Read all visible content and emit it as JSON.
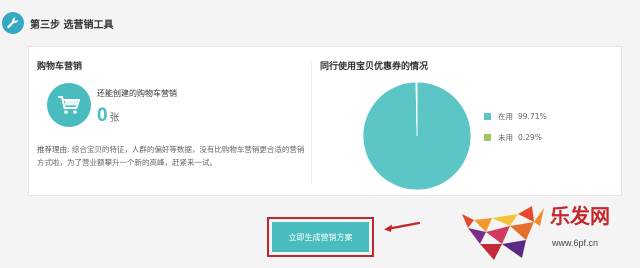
{
  "step": {
    "title": "第三步 选营销工具",
    "icon": "wrench-icon"
  },
  "left_panel": {
    "title": "购物车营销",
    "icon": "shopping-cart-icon",
    "created_label": "还能创建的购物车营销",
    "count": "0",
    "count_unit": "张",
    "reason_label": "推荐理由:",
    "reason_text": "综合宝贝的特征，人群的偏好等数据，没有比购物车营销更合适的营销方式啦，为了营业额攀升一个新的高峰，赶紧来一试。"
  },
  "right_panel": {
    "title": "同行使用宝贝优惠券的情况"
  },
  "chart_data": {
    "type": "pie",
    "title": "同行使用宝贝优惠券的情况",
    "categories": [
      "在用",
      "未用"
    ],
    "values": [
      99.71,
      0.29
    ],
    "labels": [
      "99.71%",
      "0.29%"
    ],
    "colors": [
      "#5cc6c6",
      "#9cc95f"
    ],
    "legend": "right"
  },
  "cta": {
    "label": "立即生成营销方案",
    "highlight_color": "#c0272d"
  },
  "watermark": {
    "brand": "乐发网",
    "url": "www.6pf.cn"
  },
  "colors": {
    "accent": "#48bcbf",
    "annotation": "#c0272d"
  }
}
